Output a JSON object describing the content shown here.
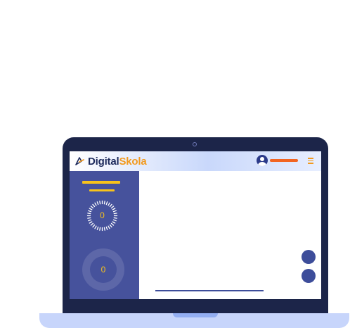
{
  "app": {
    "logo_part1": "Digital",
    "logo_part2": "Skola"
  },
  "colors": {
    "brand_navy": "#1d2a5c",
    "brand_orange": "#f29a1f",
    "sidebar": "#46529c",
    "accent_yellow": "#f7c21b",
    "user_bar": "#f26522"
  },
  "icons": {
    "logo": "pen-nib-icon",
    "user": "user-avatar-icon",
    "menu": "hamburger-menu-icon"
  },
  "sidebar": {
    "dial_value": "0",
    "ring_value": "0"
  }
}
